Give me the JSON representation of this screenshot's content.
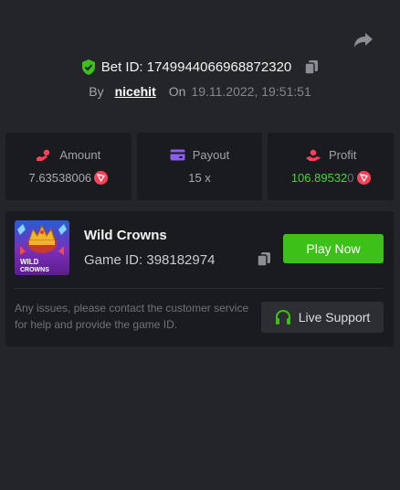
{
  "header": {
    "bet_label": "Bet ID: 1749944066968872320",
    "by_label": "By",
    "username": "nicehit",
    "on_label": "On",
    "date": "19.11.2022, 19:51:51"
  },
  "stats": {
    "amount": {
      "label": "Amount",
      "value": "7.63538006",
      "icon": "amount-icon"
    },
    "payout": {
      "label": "Payout",
      "value": "15 x",
      "icon": "wallet-icon"
    },
    "profit": {
      "label": "Profit",
      "value": "106.89532",
      "value_suffix": "0",
      "icon": "profit-icon"
    }
  },
  "currency_icon": "trx-coin-icon",
  "game": {
    "title": "Wild Crowns",
    "id_label": "Game ID: 398182974",
    "thumb_text_1": "WILD",
    "thumb_text_2": "CROWNS",
    "play_label": "Play Now"
  },
  "support": {
    "notice": "Any issues, please contact the customer service for help and provide the game ID.",
    "button_label": "Live Support"
  },
  "colors": {
    "background": "#232529",
    "panel": "#1a1b1f",
    "accent_green": "#3bc117",
    "profit_green": "#4bd33a",
    "coin_red": "#ff4259"
  }
}
